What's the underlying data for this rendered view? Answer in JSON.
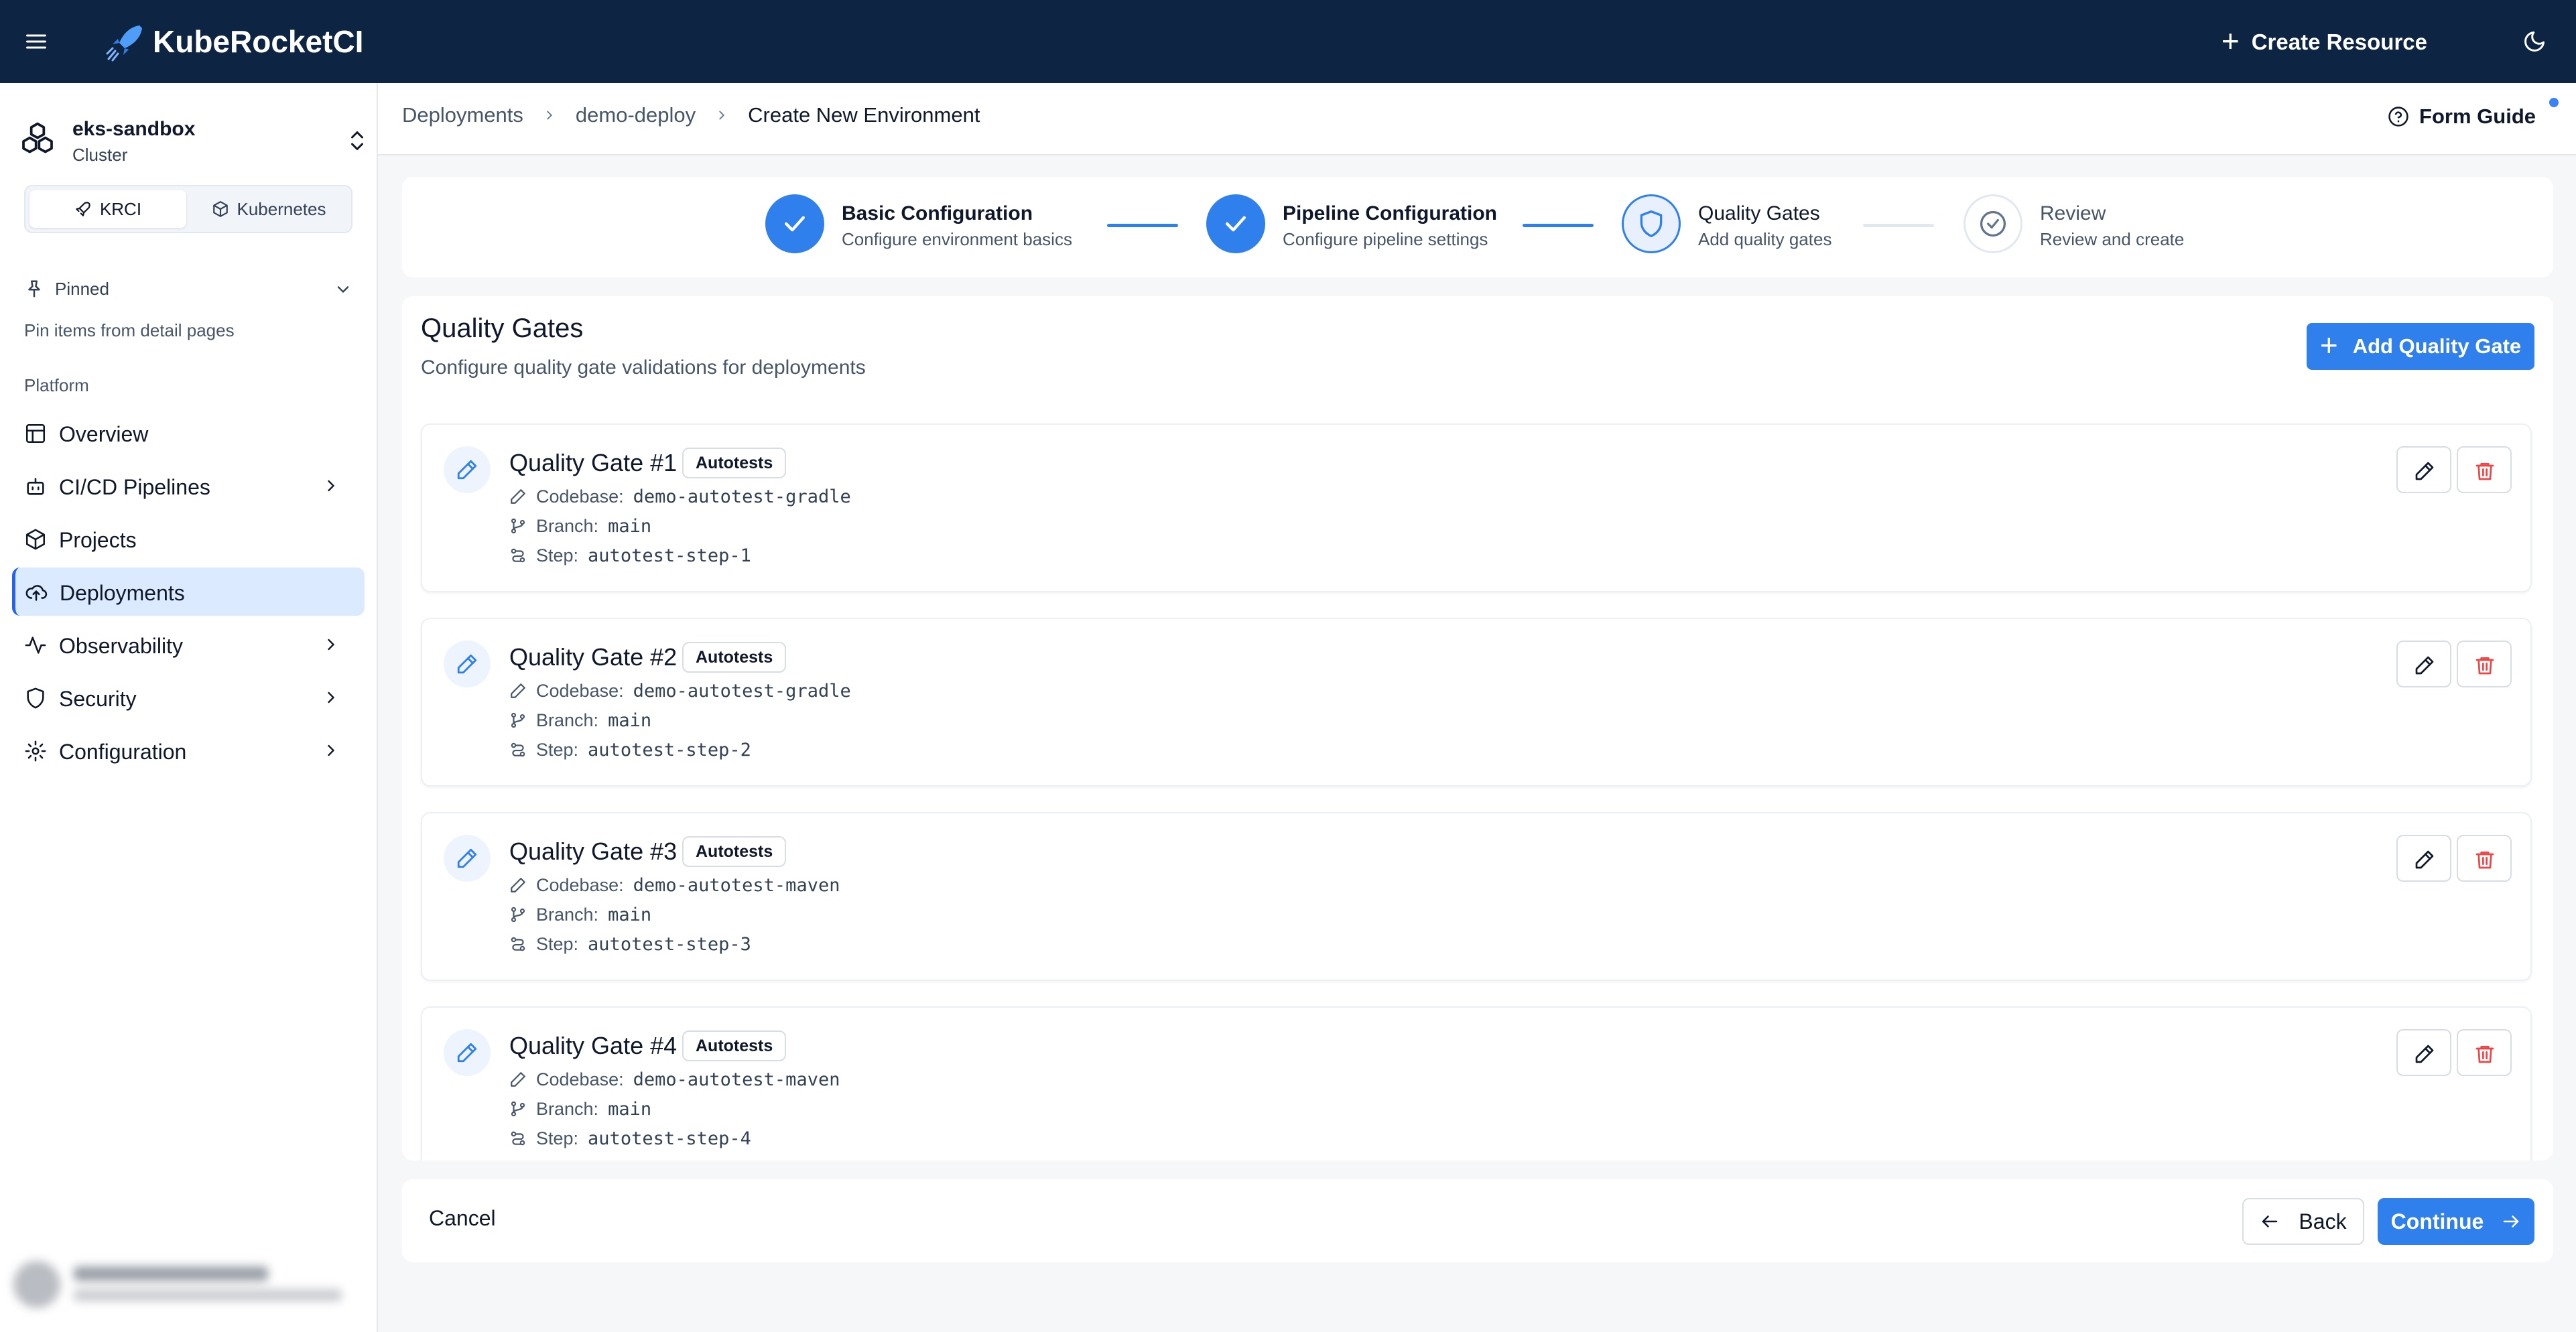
{
  "app": {
    "brand": "KubeRocketCI",
    "create_resource": "Create Resource"
  },
  "cluster": {
    "name": "eks-sandbox",
    "type": "Cluster"
  },
  "mode_switch": {
    "options": [
      "KRCI",
      "Kubernetes"
    ],
    "active": "KRCI"
  },
  "pinned": {
    "label": "Pinned",
    "hint": "Pin items from detail pages"
  },
  "nav": {
    "section": "Platform",
    "items": [
      {
        "label": "Overview",
        "icon": "layout-icon"
      },
      {
        "label": "CI/CD Pipelines",
        "icon": "bot-icon"
      },
      {
        "label": "Projects",
        "icon": "box-icon"
      },
      {
        "label": "Deployments",
        "icon": "cloud-upload-icon",
        "active": true
      },
      {
        "label": "Observability",
        "icon": "activity-icon"
      },
      {
        "label": "Security",
        "icon": "shield-icon"
      },
      {
        "label": "Configuration",
        "icon": "gear-icon"
      }
    ]
  },
  "breadcrumbs": [
    "Deployments",
    "demo-deploy",
    "Create New Environment"
  ],
  "form_guide": "Form Guide",
  "steps": [
    {
      "title": "Basic Configuration",
      "subtitle": "Configure environment basics",
      "state": "done"
    },
    {
      "title": "Pipeline Configuration",
      "subtitle": "Configure pipeline settings",
      "state": "done"
    },
    {
      "title": "Quality Gates",
      "subtitle": "Add quality gates",
      "state": "current"
    },
    {
      "title": "Review",
      "subtitle": "Review and create",
      "state": "todo"
    }
  ],
  "quality_gates": {
    "title": "Quality Gates",
    "subtitle": "Configure quality gate validations for deployments",
    "add_label": "Add Quality Gate",
    "field_labels": {
      "codebase": "Codebase:",
      "branch": "Branch:",
      "step": "Step:"
    },
    "items": [
      {
        "name": "Quality Gate #1",
        "type": "Autotests",
        "codebase": "demo-autotest-gradle",
        "branch": "main",
        "step": "autotest-step-1"
      },
      {
        "name": "Quality Gate #2",
        "type": "Autotests",
        "codebase": "demo-autotest-gradle",
        "branch": "main",
        "step": "autotest-step-2"
      },
      {
        "name": "Quality Gate #3",
        "type": "Autotests",
        "codebase": "demo-autotest-maven",
        "branch": "main",
        "step": "autotest-step-3"
      },
      {
        "name": "Quality Gate #4",
        "type": "Autotests",
        "codebase": "demo-autotest-maven",
        "branch": "main",
        "step": "autotest-step-4"
      }
    ]
  },
  "footer": {
    "cancel": "Cancel",
    "back": "Back",
    "continue": "Continue"
  },
  "colors": {
    "topbar": "#0d2543",
    "accent": "#2f80ed",
    "danger": "#ef4444",
    "nav_active_bg": "#dbeafe"
  }
}
